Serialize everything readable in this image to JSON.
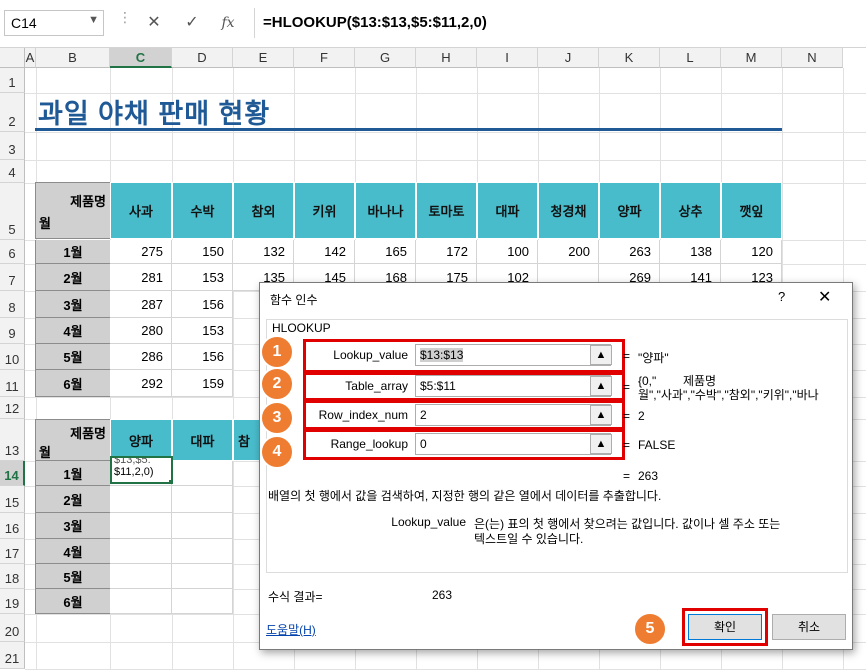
{
  "formula_bar": {
    "name_box": "C14",
    "cancel_icon": "✕",
    "enter_icon": "✓",
    "fx_label": "fx",
    "formula": "=HLOOKUP($13:$13,$5:$11,2,0)"
  },
  "columns": [
    "A",
    "B",
    "C",
    "D",
    "E",
    "F",
    "G",
    "H",
    "I",
    "J",
    "K",
    "L",
    "M",
    "N"
  ],
  "rows": [
    "1",
    "2",
    "3",
    "4",
    "5",
    "6",
    "7",
    "8",
    "9",
    "10",
    "11",
    "12",
    "13",
    "14",
    "15",
    "16",
    "17",
    "18",
    "19",
    "20",
    "21"
  ],
  "title": "과일 야채 판매 현황",
  "table1": {
    "corner_top": "제품명",
    "corner_bottom": "월",
    "headers": [
      "사과",
      "수박",
      "참외",
      "키위",
      "바나나",
      "토마토",
      "대파",
      "청경채",
      "양파",
      "상추",
      "깻잎"
    ],
    "months": [
      "1월",
      "2월",
      "3월",
      "4월",
      "5월",
      "6월"
    ],
    "row1": [
      "275",
      "150",
      "132",
      "142",
      "165",
      "172",
      "100",
      "200",
      "263",
      "138",
      "120"
    ],
    "row2_left": [
      "281",
      "153",
      "135",
      "145",
      "168",
      "175",
      "102"
    ],
    "row2_right": [
      "269",
      "141",
      "123"
    ],
    "col_c": [
      "287",
      "280",
      "286",
      "292"
    ],
    "col_d": [
      "156",
      "153",
      "156",
      "159"
    ]
  },
  "table2": {
    "corner_top": "제품명",
    "corner_bottom": "월",
    "headers": [
      "양파",
      "대파",
      "참"
    ],
    "months": [
      "1월",
      "2월",
      "3월",
      "4월",
      "5월",
      "6월"
    ],
    "c14_line1": "$13,$5:",
    "c14_line2": "$11,2,0)"
  },
  "dialog": {
    "title": "함수 인수",
    "help_icon": "?",
    "close_icon": "✕",
    "function_name": "HLOOKUP",
    "args": [
      {
        "label": "Lookup_value",
        "value": "$13:$13",
        "result": "\"양파\""
      },
      {
        "label": "Table_array",
        "value": "$5:$11",
        "result": "{0,\"        제품명",
        "result2": "월\",\"사과\",\"수박\",\"참외\",\"키위\",\"바나"
      },
      {
        "label": "Row_index_num",
        "value": "2",
        "result": "2"
      },
      {
        "label": "Range_lookup",
        "value": "0",
        "result": "FALSE"
      }
    ],
    "equals": "=",
    "overall_result": "263",
    "description": "배열의 첫 행에서 값을 검색하여, 지정한 행의 같은 열에서 데이터를 추출합니다.",
    "arg_help_name": "Lookup_value",
    "arg_help_line1": "은(는) 표의 첫 행에서 찾으려는 값입니다. 값이나 셀 주소 또는",
    "arg_help_line2": "텍스트일 수 있습니다.",
    "formula_result_label": "수식 결과=",
    "formula_result_value": "263",
    "help_link": "도움말(H)",
    "ok_label": "확인",
    "cancel_label": "취소"
  },
  "badges": [
    "1",
    "2",
    "3",
    "4",
    "5"
  ],
  "colors": {
    "header_teal": "#49bccb",
    "title_blue": "#1f5a96",
    "badge_orange": "#ee7d31",
    "highlight_red": "#e00000",
    "excel_green": "#217346"
  }
}
